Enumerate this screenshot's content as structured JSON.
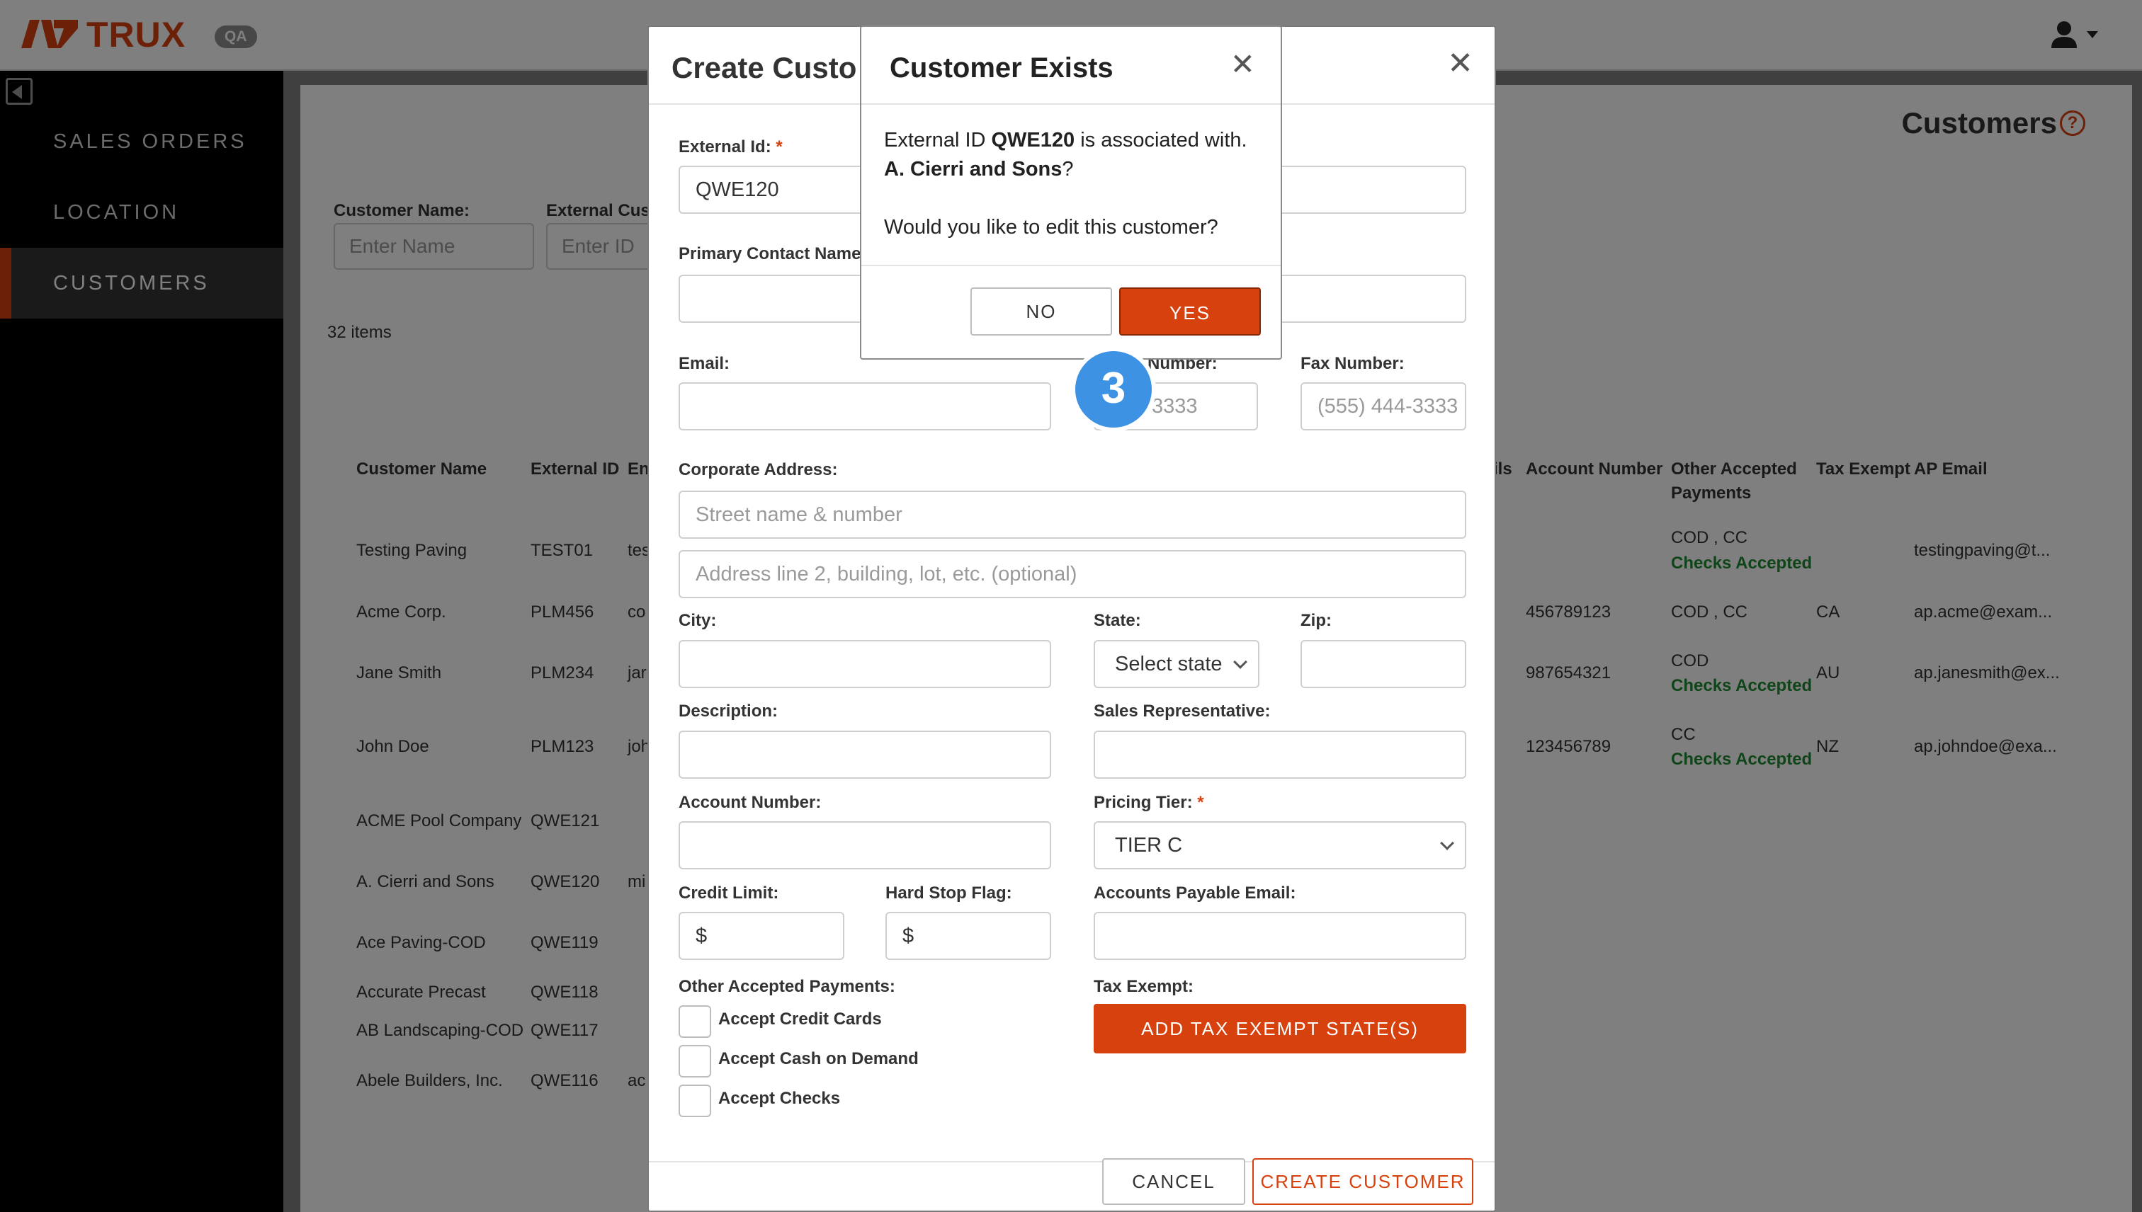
{
  "app": {
    "brand": "TRUX",
    "env_badge": "QA"
  },
  "sidebar": {
    "items": [
      {
        "label": "SALES ORDERS"
      },
      {
        "label": "LOCATION"
      },
      {
        "label": "CUSTOMERS"
      }
    ]
  },
  "page": {
    "title": "Customers",
    "filters": {
      "customer_name_label": "Customer Name:",
      "customer_name_placeholder": "Enter Name",
      "external_id_label": "External Cus",
      "external_id_placeholder": "Enter ID"
    },
    "items_count": "32 items",
    "table": {
      "headers": [
        "Customer Name",
        "External ID",
        "En",
        "ils",
        "Account Number",
        "Other Accepted Payments",
        "Tax Exempt",
        "AP Email"
      ],
      "rows": [
        {
          "name": "Testing Paving",
          "ext_id": "TEST01",
          "email": "tes",
          "account": "",
          "payments": "COD , CC",
          "checks": "Checks Accepted",
          "tax": "",
          "ap_email": "testingpaving@t..."
        },
        {
          "name": "Acme Corp.",
          "ext_id": "PLM456",
          "email": "co",
          "account": "456789123",
          "payments": "COD , CC",
          "checks": "",
          "tax": "CA",
          "ap_email": "ap.acme@exam..."
        },
        {
          "name": "Jane Smith",
          "ext_id": "PLM234",
          "email": "jar",
          "account": "987654321",
          "payments": "COD",
          "checks": "Checks Accepted",
          "tax": "AU",
          "ap_email": "ap.janesmith@ex..."
        },
        {
          "name": "John Doe",
          "ext_id": "PLM123",
          "email": "joh",
          "account": "123456789",
          "payments": "CC",
          "checks": "Checks Accepted",
          "tax": "NZ",
          "ap_email": "ap.johndoe@exa..."
        },
        {
          "name": "ACME Pool Company",
          "ext_id": "QWE121",
          "email": "",
          "account": "",
          "payments": "",
          "checks": "",
          "tax": "",
          "ap_email": ""
        },
        {
          "name": "A. Cierri and Sons",
          "ext_id": "QWE120",
          "email": "mi",
          "account": "",
          "payments": "",
          "checks": "",
          "tax": "",
          "ap_email": ""
        },
        {
          "name": "Ace Paving-COD",
          "ext_id": "QWE119",
          "email": "",
          "account": "",
          "payments": "",
          "checks": "",
          "tax": "",
          "ap_email": ""
        },
        {
          "name": "Accurate Precast",
          "ext_id": "QWE118",
          "email": "",
          "account": "",
          "payments": "",
          "checks": "",
          "tax": "",
          "ap_email": ""
        },
        {
          "name": "AB Landscaping-COD",
          "ext_id": "QWE117",
          "email": "",
          "account": "",
          "payments": "",
          "checks": "",
          "tax": "",
          "ap_email": ""
        },
        {
          "name": "Abele Builders, Inc.",
          "ext_id": "QWE116",
          "email": "ac",
          "account": "",
          "payments": "",
          "checks": "",
          "tax": "",
          "ap_email": ""
        }
      ]
    }
  },
  "create_modal": {
    "title": "Create Custo",
    "fields": {
      "external_id": {
        "label": "External Id:",
        "value": "QWE120"
      },
      "primary_contact": {
        "label": "Primary Contact Name"
      },
      "email": {
        "label": "Email:"
      },
      "phone": {
        "label": "Number:",
        "placeholder": "444-3333"
      },
      "fax": {
        "label": "Fax Number:",
        "placeholder": "(555) 444-3333"
      },
      "corporate_address": {
        "label": "Corporate Address:",
        "placeholder": "Street name & number"
      },
      "address_line2": {
        "placeholder": "Address line 2, building, lot, etc. (optional)"
      },
      "city": {
        "label": "City:"
      },
      "state": {
        "label": "State:",
        "value": "Select state"
      },
      "zip": {
        "label": "Zip:"
      },
      "description": {
        "label": "Description:"
      },
      "sales_rep": {
        "label": "Sales Representative:"
      },
      "account_number": {
        "label": "Account Number:"
      },
      "pricing_tier": {
        "label": "Pricing Tier:",
        "value": "TIER C"
      },
      "credit_limit": {
        "label": "Credit Limit:",
        "prefix": "$"
      },
      "hard_stop": {
        "label": "Hard Stop Flag:",
        "prefix": "$"
      },
      "ap_email": {
        "label": "Accounts Payable Email:"
      },
      "other_payments": {
        "label": "Other Accepted Payments:"
      },
      "tax_exempt": {
        "label": "Tax Exempt:"
      }
    },
    "required_mark": "*",
    "checkboxes": [
      "Accept Credit Cards",
      "Accept Cash on Demand",
      "Accept Checks"
    ],
    "add_tax_exempt_button": "ADD TAX EXEMPT STATE(S)",
    "cancel_button": "CANCEL",
    "create_button": "CREATE CUSTOMER"
  },
  "exists_dialog": {
    "title": "Customer Exists",
    "text_1": "External ID ",
    "external_id": "QWE120",
    "text_2": " is associated with.",
    "customer_name": "A. Cierri and Sons",
    "text_3": "?",
    "question": "Would you like to edit this customer?",
    "no_button": "NO",
    "yes_button": "YES"
  },
  "step_badge": "3",
  "colors": {
    "accent": "#d7410e",
    "step_badge": "#3d92e3",
    "checks_accepted": "#1e8a32"
  },
  "icons": [
    "trux-logo-icon",
    "user-icon",
    "caret-down-icon",
    "collapse-sidebar-icon",
    "help-icon",
    "close-icon",
    "chevron-down-icon"
  ]
}
